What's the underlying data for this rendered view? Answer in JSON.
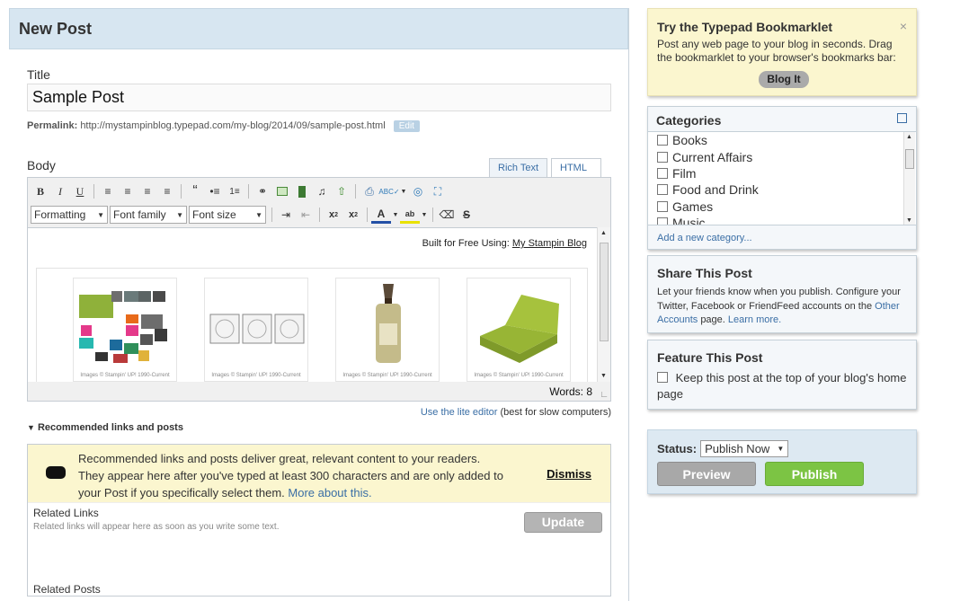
{
  "page": {
    "title": "New Post"
  },
  "post": {
    "title_label": "Title",
    "title_value": "Sample Post",
    "permalink_label": "Permalink:",
    "permalink_url": "http://mystampinblog.typepad.com/my-blog/2014/09/sample-post.html",
    "permalink_edit": "Edit",
    "body_label": "Body"
  },
  "editor": {
    "tabs": [
      {
        "label": "Rich Text",
        "active": true
      },
      {
        "label": "HTML",
        "active": false
      }
    ],
    "selects": {
      "format": "Formatting",
      "font_family": "Font family",
      "font_size": "Font size"
    },
    "built_text": "Built for Free Using:",
    "built_link": "My Stampin Blog",
    "image_caption": "Images © Stampin' UP! 1990-Current",
    "word_count": "Words: 8",
    "lite_link": "Use the lite editor",
    "lite_note": "(best for slow computers)"
  },
  "recommended": {
    "heading": "Recommended links and posts",
    "notice": "Recommended links and posts deliver great, relevant content to your readers. They appear here after you've typed at least 300 characters and are only added to your Post if you specifically select them.",
    "more_link": "More about this.",
    "dismiss": "Dismiss",
    "related_links_label": "Related Links",
    "related_links_note": "Related links will appear here as soon as you write some text.",
    "update_label": "Update",
    "related_posts_label": "Related Posts"
  },
  "sidebar": {
    "bookmarklet": {
      "title": "Try the Typepad Bookmarklet",
      "text": "Post any web page to your blog in seconds. Drag the bookmarklet to your browser's bookmarks bar:",
      "button": "Blog It",
      "close": "×"
    },
    "categories": {
      "title": "Categories",
      "items": [
        "Books",
        "Current Affairs",
        "Film",
        "Food and Drink",
        "Games",
        "Music"
      ],
      "add_link": "Add a new category..."
    },
    "share": {
      "title": "Share This Post",
      "text_before": "Let your friends know when you publish. Configure your Twitter, Facebook or FriendFeed accounts on the",
      "accounts_link": "Other Accounts",
      "text_after": "page.",
      "learn_link": "Learn more."
    },
    "feature": {
      "title": "Feature This Post",
      "text": "Keep this post at the top of your blog's home page"
    },
    "publish": {
      "status_label": "Status:",
      "status_value": "Publish Now",
      "preview": "Preview",
      "publish": "Publish"
    }
  },
  "colors": {
    "header_bg": "#d7e6f1",
    "notice_bg": "#fbf6cf",
    "publish_green": "#7cc444",
    "link_blue": "#3a6ea5"
  }
}
